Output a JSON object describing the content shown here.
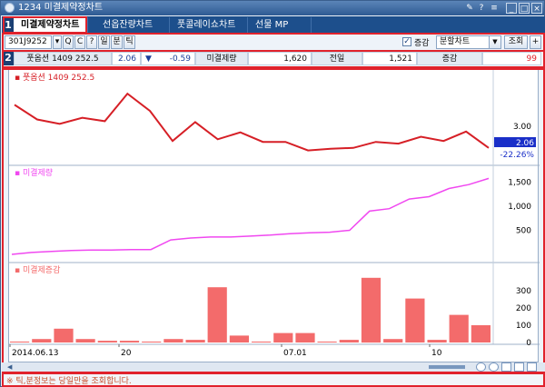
{
  "window": {
    "title": "1234 미결제약정차트"
  },
  "tabs": [
    {
      "label": "미결제약정차트",
      "active": true
    },
    {
      "label": "선옵잔량차트",
      "active": false
    },
    {
      "label": "풋콜레이쇼차트",
      "active": false
    },
    {
      "label": "선물 MP",
      "active": false
    }
  ],
  "badges": {
    "one": "1",
    "two": "2"
  },
  "toolbar": {
    "code": "301J9252",
    "btn_q": "Q",
    "btn_c": "C",
    "btn_q2": "?",
    "btn_day": "일",
    "btn_min": "분",
    "btn_tick": "틱",
    "checkbox_label": "증감",
    "checkbox_checked": true,
    "view_select": "분할차트",
    "search_button": "조회",
    "plus_button": "+"
  },
  "quote": {
    "name": "풋옵션 1409 252.5",
    "price": "2.06",
    "change_arrow": "▼",
    "change": "-0.59",
    "oi_label": "미결제량",
    "oi_value": "1,620",
    "prev_label": "전일",
    "prev_value": "1,521",
    "diff_label": "증감",
    "diff_value": "99"
  },
  "chart_data": [
    {
      "type": "line",
      "title": "풋옵션 1409 252.5",
      "color": "#d61f26",
      "values": [
        3.25,
        3.08,
        3.03,
        3.1,
        3.06,
        3.38,
        3.18,
        2.83,
        3.05,
        2.85,
        2.93,
        2.82,
        2.82,
        2.72,
        2.74,
        2.75,
        2.82,
        2.8,
        2.88,
        2.83,
        2.94,
        2.75
      ],
      "y_ticks": [
        "3.00"
      ],
      "last_label": "2.06",
      "last_pct": "-22.26%"
    },
    {
      "type": "line",
      "title": "미결제량",
      "color": "#f048f0",
      "values": [
        0,
        40,
        60,
        80,
        90,
        90,
        100,
        100,
        300,
        340,
        360,
        360,
        380,
        400,
        430,
        450,
        460,
        500,
        900,
        950,
        1150,
        1200,
        1370,
        1450,
        1580
      ],
      "y_ticks": [
        "1,500",
        "1,000",
        "500"
      ]
    },
    {
      "type": "bar",
      "title": "미결제증감",
      "color": "#f36b6b",
      "values": [
        0,
        20,
        80,
        20,
        10,
        10,
        0,
        20,
        15,
        320,
        40,
        5,
        55,
        55,
        5,
        15,
        375,
        20,
        255,
        15,
        160,
        100
      ],
      "y_ticks": [
        "300",
        "200",
        "100",
        "0"
      ]
    }
  ],
  "x_axis": {
    "labels": [
      "2014.06.13",
      "20",
      "07.01",
      "10"
    ]
  },
  "status": {
    "message": "※ 틱,분정보는 당일만을 조회합니다."
  },
  "colors": {
    "frame_red": "#e0222c",
    "tab_bar": "#1d4f8c",
    "price_up_down": "#1b3f9a"
  }
}
